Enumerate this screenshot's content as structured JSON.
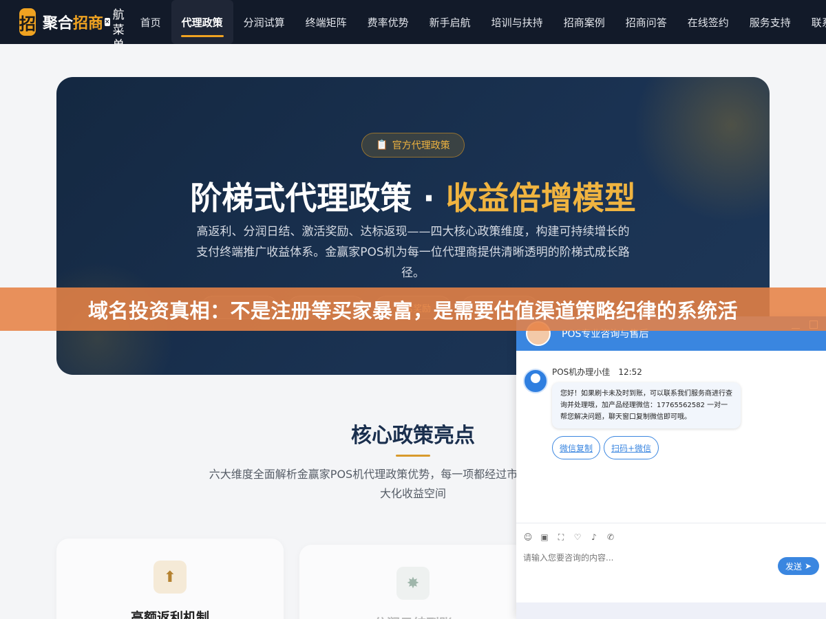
{
  "colors": {
    "nav_bg": "#121a29",
    "accent": "#f0a321",
    "hero_bg": "#1a3252",
    "banner": "#e68246",
    "chat_blue": "#3a86e0"
  },
  "nav": {
    "logo_char": "招",
    "brand_a": "聚合",
    "brand_b": "招商",
    "close": "×",
    "menu_label": "航菜单",
    "items": [
      "首页",
      "代理政策",
      "分润试算",
      "终端矩阵",
      "费率优势",
      "新手启航",
      "培训与扶持",
      "招商案例",
      "招商问答",
      "在线签约",
      "服务支持",
      "联系"
    ],
    "active_index": 1
  },
  "hero": {
    "badge_icon": "clipboard-icon",
    "badge": "官方代理政策",
    "title_main": "阶梯式代理政策 · ",
    "title_accent": "收益倍增模型",
    "desc": "高返利、分润日结、激活奖励、达标返现——四大核心政策维度，构建可持续增长的支付终端推广收益体系。金赢家POS机为每一位代理商提供清晰透明的阶梯式成长路径。",
    "tags": [
      "",
      "",
      "激活奖励",
      ""
    ]
  },
  "banner": {
    "text": "域名投资真相：不是注册等买家暴富，是需要估值渠道策略纪律的系统活"
  },
  "section": {
    "title": "核心政策亮点",
    "desc": "六大维度全面解析金赢家POS机代理政策优势，每一项都经过市场验证，为您创造最大化收益空间"
  },
  "cards": [
    {
      "title": "高额返利机制",
      "icon": "⬆"
    },
    {
      "title": "分润日结到账",
      "icon": "✸"
    }
  ],
  "chat": {
    "header_title": "POS专业咨询与售后",
    "agent_name": "POS机办理小佳",
    "time": "12:52",
    "message": "您好！如果刷卡未及时到账，可以联系我们服务商进行查询并处理哦，加产品经理微信：17765562582 一对一帮您解决问题，聊天窗口复制微信即可哦。",
    "btn_wechat": "微信复制",
    "btn_scan": "扫码+微信",
    "tools": [
      "☺",
      "▣",
      "⛶",
      "♡",
      "♪",
      "✆"
    ],
    "input_placeholder": "请输入您要咨询的内容...",
    "send": "发送"
  }
}
